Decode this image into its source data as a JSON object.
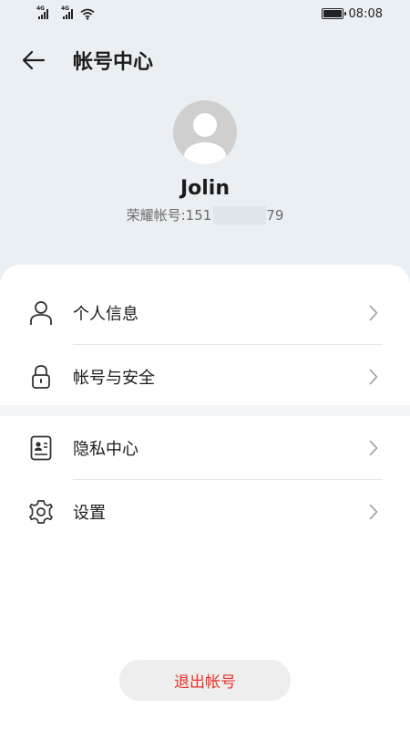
{
  "status_bar": {
    "signal1_label": "4G",
    "signal2_label": "4G",
    "time": "08:08"
  },
  "header": {
    "title": "帐号中心"
  },
  "profile": {
    "name": "Jolin",
    "account_label": "荣耀帐号: ",
    "account_prefix": "151",
    "account_suffix": "79"
  },
  "menu": {
    "personal_info": "个人信息",
    "account_security": "帐号与安全",
    "privacy_center": "隐私中心",
    "settings": "设置"
  },
  "logout_label": "退出帐号",
  "colors": {
    "background": "#e9eff3",
    "accent_red": "#e8312a",
    "text": "#1c1c1c"
  },
  "icons": {
    "back": "back-arrow-icon",
    "personal_info": "person-icon",
    "account_security": "lock-icon",
    "privacy_center": "id-card-icon",
    "settings": "gear-icon",
    "chevron": "chevron-right-icon"
  }
}
